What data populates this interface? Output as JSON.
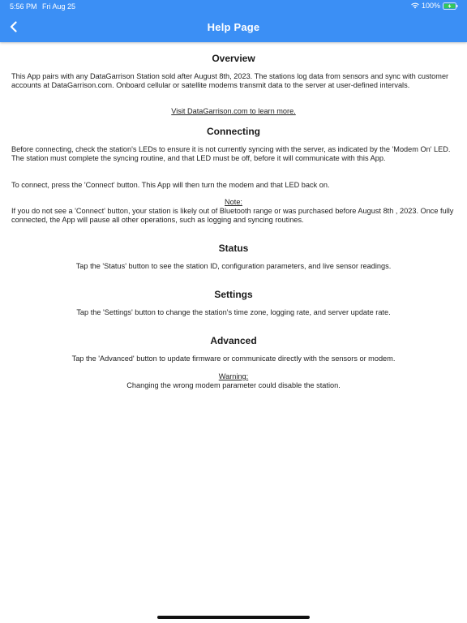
{
  "status_bar": {
    "time": "5:56 PM",
    "date": "Fri Aug 25",
    "battery": "100%"
  },
  "header": {
    "title": "Help Page",
    "back_icon": "chevron-left-icon"
  },
  "colors": {
    "header_bg": "#3b8ff5",
    "battery_fill": "#34c759"
  },
  "sections": {
    "overview": {
      "title": "Overview",
      "body": "This App pairs with any DataGarrison Station sold after August 8th, 2023. The stations log data from sensors and sync with customer accounts at DataGarrison.com. Onboard cellular or satellite modems transmit data to the server at user-defined intervals.",
      "link": "Visit DataGarrison.com to learn more."
    },
    "connecting": {
      "title": "Connecting",
      "body1": "Before connecting, check the station's LEDs to ensure it is not currently syncing with the server, as indicated by the 'Modem On' LED. The station must complete the syncing routine, and that LED must be off, before it will communicate with this App.",
      "body2": "To connect, press the 'Connect' button. This App will then turn the modem and that LED back on.",
      "note_label": "Note:",
      "note_body": "If you do not see a 'Connect' button, your station is likely out of Bluetooth range or was purchased before August 8th , 2023. Once fully connected, the App will pause all other operations, such as logging and syncing routines."
    },
    "status": {
      "title": "Status",
      "body": "Tap the 'Status' button to see the station ID, configuration parameters, and live sensor readings."
    },
    "settings": {
      "title": "Settings",
      "body": "Tap the 'Settings' button to change the station's time zone, logging rate, and server update rate."
    },
    "advanced": {
      "title": "Advanced",
      "body": "Tap the 'Advanced' button to update firmware or communicate directly with the sensors or modem.",
      "warning_label": "Warning:",
      "warning_body": "Changing the wrong modem parameter could disable the station."
    }
  }
}
